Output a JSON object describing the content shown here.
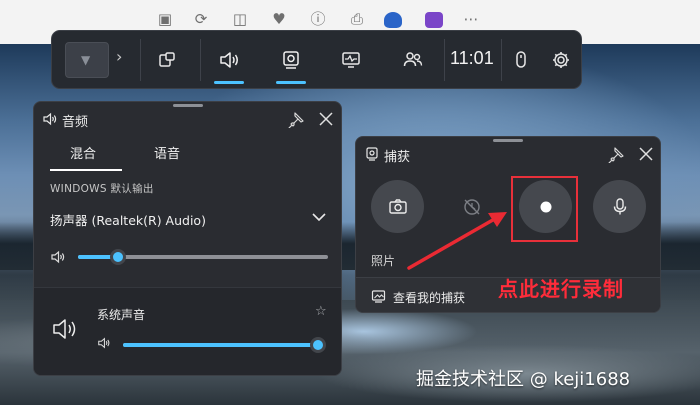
{
  "game_bar": {
    "time": "11:01"
  },
  "audio_panel": {
    "title": "音频",
    "tabs": [
      {
        "label": "混合",
        "active": true
      },
      {
        "label": "语音",
        "active": false
      }
    ],
    "output_section_label": "WINDOWS 默认输出",
    "device_name": "扬声器 (Realtek(R) Audio)",
    "device_volume_fraction": 0.16,
    "apps": [
      {
        "name": "系统声音",
        "volume_fraction": 1.0
      }
    ]
  },
  "capture_panel": {
    "title": "捕获",
    "buttons": [
      {
        "icon": "camera-icon"
      },
      {
        "icon": "record-last-30s-icon",
        "disabled": true
      },
      {
        "icon": "record-dot-icon"
      },
      {
        "icon": "microphone-icon"
      }
    ],
    "photo_label": "照片",
    "view_captures_label": "查看我的捕获"
  },
  "annotation": {
    "callout": "点此进行录制",
    "color": "#ff2c3a"
  },
  "watermark": "掘金技术社区 @ keji1688",
  "colors": {
    "accent": "#4cc2ff",
    "panel": "#2a2c31",
    "gamebar": "#262a30"
  }
}
